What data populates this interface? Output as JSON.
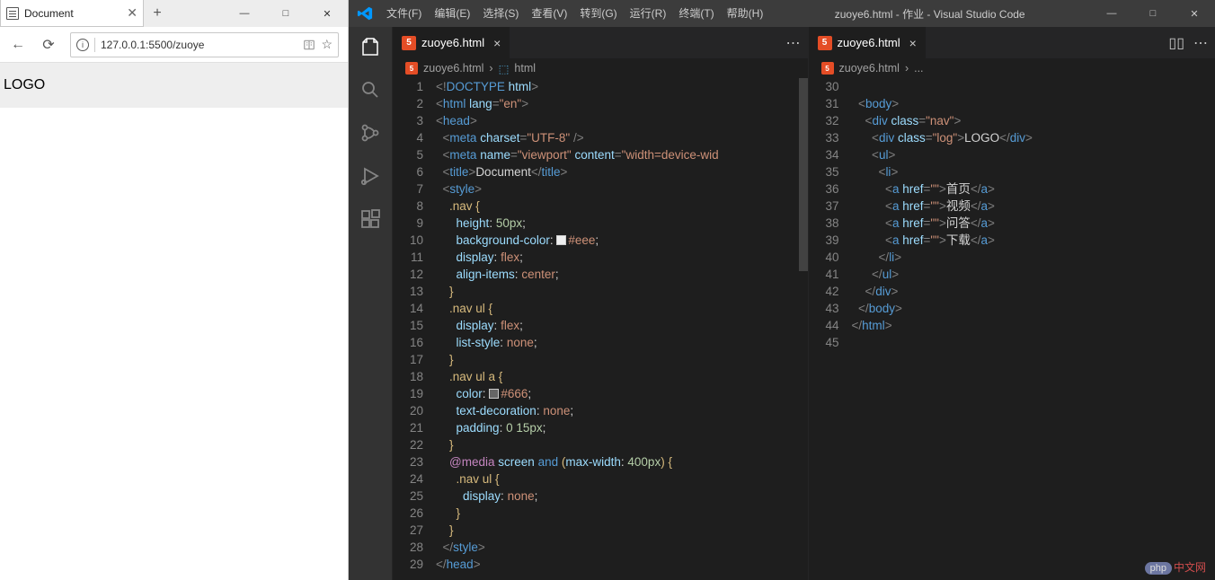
{
  "browser": {
    "tab_title": "Document",
    "new_tab": "+",
    "win_min": "—",
    "win_max": "□",
    "win_close": "✕",
    "back": "←",
    "refresh": "⟳",
    "info_icon": "i",
    "url": "127.0.0.1:5500/zuoye",
    "star": "☆",
    "page_logo": "LOGO"
  },
  "vscode": {
    "menus": [
      "文件(F)",
      "编辑(E)",
      "选择(S)",
      "查看(V)",
      "转到(G)",
      "运行(R)",
      "终端(T)",
      "帮助(H)"
    ],
    "title": "zuoye6.html - 作业 - Visual Studio Code",
    "win_min": "—",
    "win_max": "□",
    "win_close": "✕",
    "tab1_name": "zuoye6.html",
    "tab2_name": "zuoye6.html",
    "bc1_file": "zuoye6.html",
    "bc1_sep": "›",
    "bc1_sym": "html",
    "bc2_file": "zuoye6.html",
    "bc2_sep": "›",
    "bc2_more": "...",
    "more_icon": "⋯",
    "split_icon": "▯▯",
    "watermark_php": "php",
    "watermark_cn": "中文网"
  },
  "code_left": {
    "start": 1,
    "lines": [
      "<span class='p'>&lt;!</span><span class='t'>DOCTYPE</span> <span class='a'>html</span><span class='p'>&gt;</span>",
      "<span class='p'>&lt;</span><span class='t'>html</span> <span class='a'>lang</span><span class='p'>=</span><span class='s'>\"en\"</span><span class='p'>&gt;</span>",
      "<span class='p'>&lt;</span><span class='t'>head</span><span class='p'>&gt;</span>",
      "  <span class='p'>&lt;</span><span class='t'>meta</span> <span class='a'>charset</span><span class='p'>=</span><span class='s'>\"UTF-8\"</span> <span class='p'>/&gt;</span>",
      "  <span class='p'>&lt;</span><span class='t'>meta</span> <span class='a'>name</span><span class='p'>=</span><span class='s'>\"viewport\"</span> <span class='a'>content</span><span class='p'>=</span><span class='s'>\"width=device-wid</span>",
      "  <span class='p'>&lt;</span><span class='t'>title</span><span class='p'>&gt;</span><span class='w'>Document</span><span class='p'>&lt;/</span><span class='t'>title</span><span class='p'>&gt;</span>",
      "  <span class='p'>&lt;</span><span class='t'>style</span><span class='p'>&gt;</span>",
      "    <span class='y'>.nav {</span>",
      "      <span class='a'>height</span><span class='w'>:</span> <span class='n'>50px</span><span class='w'>;</span>",
      "      <span class='a'>background-color</span><span class='w'>:</span> <span class='swatch' style='background:#eee'></span><span class='s'>#eee</span><span class='w'>;</span>",
      "      <span class='a'>display</span><span class='w'>:</span> <span class='s'>flex</span><span class='w'>;</span>",
      "      <span class='a'>align-items</span><span class='w'>:</span> <span class='s'>center</span><span class='w'>;</span>",
      "    <span class='y'>}</span>",
      "    <span class='y'>.nav ul {</span>",
      "      <span class='a'>display</span><span class='w'>:</span> <span class='s'>flex</span><span class='w'>;</span>",
      "      <span class='a'>list-style</span><span class='w'>:</span> <span class='s'>none</span><span class='w'>;</span>",
      "    <span class='y'>}</span>",
      "    <span class='y'>.nav ul a {</span>",
      "      <span class='a'>color</span><span class='w'>:</span> <span class='swatch' style='background:#666'></span><span class='s'>#666</span><span class='w'>;</span>",
      "      <span class='a'>text-decoration</span><span class='w'>:</span> <span class='s'>none</span><span class='w'>;</span>",
      "      <span class='a'>padding</span><span class='w'>:</span> <span class='n'>0</span> <span class='n'>15px</span><span class='w'>;</span>",
      "    <span class='y'>}</span>",
      "    <span class='k'>@media</span> <span class='a'>screen</span> <span class='t'>and</span> <span class='y'>(</span><span class='a'>max-width</span><span class='w'>:</span> <span class='n'>400px</span><span class='y'>)</span> <span class='y'>{</span>",
      "      <span class='y'>.nav ul {</span>",
      "        <span class='a'>display</span><span class='w'>:</span> <span class='s'>none</span><span class='w'>;</span>",
      "      <span class='y'>}</span>",
      "    <span class='y'>}</span>",
      "  <span class='p'>&lt;/</span><span class='t'>style</span><span class='p'>&gt;</span>",
      "<span class='p'>&lt;/</span><span class='t'>head</span><span class='p'>&gt;</span>"
    ]
  },
  "code_right": {
    "start": 30,
    "lines": [
      "",
      "  <span class='p'>&lt;</span><span class='t'>body</span><span class='p'>&gt;</span>",
      "    <span class='p'>&lt;</span><span class='t'>div</span> <span class='a'>class</span><span class='p'>=</span><span class='s'>\"nav\"</span><span class='p'>&gt;</span>",
      "      <span class='p'>&lt;</span><span class='t'>div</span> <span class='a'>class</span><span class='p'>=</span><span class='s'>\"log\"</span><span class='p'>&gt;</span><span class='w'>LOGO</span><span class='p'>&lt;/</span><span class='t'>div</span><span class='p'>&gt;</span>",
      "      <span class='p'>&lt;</span><span class='t'>ul</span><span class='p'>&gt;</span>",
      "        <span class='p'>&lt;</span><span class='t'>li</span><span class='p'>&gt;</span>",
      "          <span class='p'>&lt;</span><span class='t'>a</span> <span class='a'>href</span><span class='p'>=</span><span class='s'>\"\"</span><span class='p'>&gt;</span><span class='w'>首页</span><span class='p'>&lt;/</span><span class='t'>a</span><span class='p'>&gt;</span>",
      "          <span class='p'>&lt;</span><span class='t'>a</span> <span class='a'>href</span><span class='p'>=</span><span class='s'>\"\"</span><span class='p'>&gt;</span><span class='w'>视频</span><span class='p'>&lt;/</span><span class='t'>a</span><span class='p'>&gt;</span>",
      "          <span class='p'>&lt;</span><span class='t'>a</span> <span class='a'>href</span><span class='p'>=</span><span class='s'>\"\"</span><span class='p'>&gt;</span><span class='w'>问答</span><span class='p'>&lt;/</span><span class='t'>a</span><span class='p'>&gt;</span>",
      "          <span class='p'>&lt;</span><span class='t'>a</span> <span class='a'>href</span><span class='p'>=</span><span class='s'>\"\"</span><span class='p'>&gt;</span><span class='w'>下载</span><span class='p'>&lt;/</span><span class='t'>a</span><span class='p'>&gt;</span>",
      "        <span class='p'>&lt;/</span><span class='t'>li</span><span class='p'>&gt;</span>",
      "      <span class='p'>&lt;/</span><span class='t'>ul</span><span class='p'>&gt;</span>",
      "    <span class='p'>&lt;/</span><span class='t'>div</span><span class='p'>&gt;</span>",
      "  <span class='p'>&lt;/</span><span class='t'>body</span><span class='p'>&gt;</span>",
      "<span class='p'>&lt;/</span><span class='t'>html</span><span class='p'>&gt;</span>",
      ""
    ]
  }
}
